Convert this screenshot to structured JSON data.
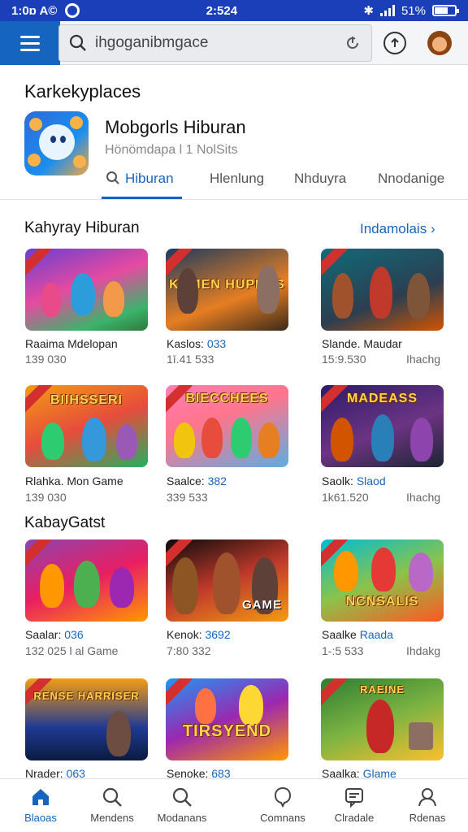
{
  "status_bar": {
    "left_text": "1:0ɒ A©",
    "time": "2:524",
    "right_text": "51%"
  },
  "search": {
    "placeholder": "ihgoganibmgace"
  },
  "header": {
    "section_title": "Karkekyplaces",
    "app_name": "Mobgorls Hiburan",
    "app_subtitle": "Hönömdapa l 1 NolSits"
  },
  "tabs": [
    {
      "label": "Hiburan",
      "active": true
    },
    {
      "label": "Hlenlung",
      "active": false
    },
    {
      "label": "Nhduyra",
      "active": false
    },
    {
      "label": "Nnodanige",
      "active": false
    }
  ],
  "category1": {
    "title": "Kahyray Hiburan",
    "see_all": "Indamolais",
    "games": [
      {
        "name": "Raaima Mdelopan",
        "name_hl": "",
        "meta": "139 030",
        "extra": "",
        "overlay": ""
      },
      {
        "name": "Kaslos: ",
        "name_hl": "033",
        "meta": "1ī.41 533",
        "extra": "",
        "overlay": "KAMEN HUPBRS"
      },
      {
        "name": "Slande. Maudar",
        "name_hl": "",
        "meta": "15:9.530",
        "extra": "Ihachg",
        "overlay": ""
      },
      {
        "name": "Rlahka. Mon Game",
        "name_hl": "",
        "meta": "139 030",
        "extra": "",
        "overlay": "BIIHSSERI"
      },
      {
        "name": "Saalce: ",
        "name_hl": "382",
        "meta": "339 533",
        "extra": "",
        "overlay": "BIECCHEES"
      },
      {
        "name": "Saolk: ",
        "name_hl": "Slaod",
        "meta": "1k61.520",
        "extra": "Ihachg",
        "overlay": "MADEASS"
      }
    ]
  },
  "category2": {
    "title": "KabayGatst",
    "games": [
      {
        "name": "Saalar: ",
        "name_hl": "036",
        "meta": "132 025 l al Game",
        "extra": "",
        "overlay": ""
      },
      {
        "name": "Kenok: ",
        "name_hl": "3692",
        "meta": "7:80 332",
        "extra": "",
        "overlay": "GAME"
      },
      {
        "name": "Saalke ",
        "name_hl": "Raada",
        "meta": "1‑:5 533",
        "extra": "Ihdakg",
        "overlay": "NCNSALIS"
      },
      {
        "name": "Nrader: ",
        "name_hl": "063",
        "meta": "",
        "extra": "",
        "overlay": "RENSE HARRISER"
      },
      {
        "name": "Senoke: ",
        "name_hl": "683",
        "meta": "",
        "extra": "",
        "overlay": "TIRSYEND"
      },
      {
        "name": "Saalka: ",
        "name_hl": "Glame",
        "meta": "",
        "extra": "",
        "overlay": "RAEINE"
      }
    ]
  },
  "bottom_nav": [
    {
      "label": "Blaoas",
      "icon": "home-icon",
      "active": true
    },
    {
      "label": "Mendens",
      "icon": "search-icon",
      "active": false
    },
    {
      "label": "Modanans",
      "icon": "search-icon",
      "active": false
    },
    {
      "label": "Comnans",
      "icon": "chat-icon",
      "active": false
    },
    {
      "label": "Clradale",
      "icon": "message-icon",
      "active": false
    },
    {
      "label": "Rdenas",
      "icon": "profile-icon",
      "active": false
    }
  ],
  "colors": {
    "accent": "#1565c0",
    "statusbar": "#1a3fb8"
  }
}
